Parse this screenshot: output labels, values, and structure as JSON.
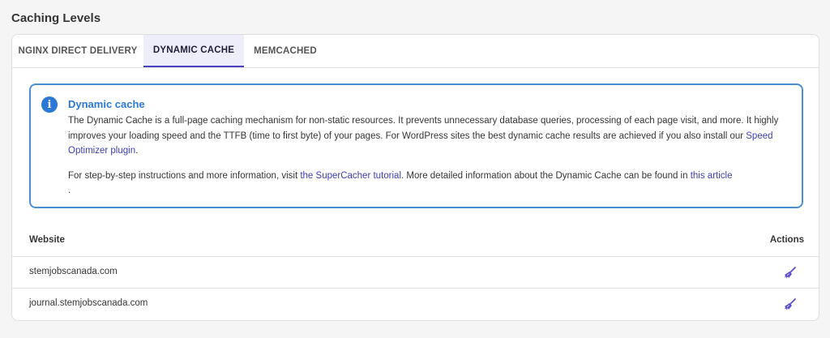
{
  "page": {
    "title": "Caching Levels"
  },
  "tabs": [
    {
      "label": "NGINX DIRECT DELIVERY",
      "active": false
    },
    {
      "label": "DYNAMIC CACHE",
      "active": true
    },
    {
      "label": "MEMCACHED",
      "active": false
    }
  ],
  "notice": {
    "title": "Dynamic cache",
    "icon": "info-icon",
    "p1_text": "The Dynamic Cache is a full-page caching mechanism for non-static resources. It prevents unnecessary database queries, processing of each page visit, and more. It highly improves your loading speed and the TTFB (time to first byte) of your pages. For WordPress sites the best dynamic cache results are achieved if you also install our ",
    "p1_link": "Speed Optimizer plugin",
    "p1_end": ".",
    "p2_text": "For step-by-step instructions and more information, visit ",
    "p2_link1": "the SuperCacher tutorial",
    "p2_mid": ". More detailed information about the Dynamic Cache can be found in ",
    "p2_link2": "this article",
    "p2_end": "."
  },
  "table": {
    "col_website": "Website",
    "col_actions": "Actions",
    "rows": [
      {
        "website": "stemjobscanada.com",
        "action_icon": "broom-icon"
      },
      {
        "website": "journal.stemjobscanada.com",
        "action_icon": "broom-icon"
      }
    ]
  },
  "colors": {
    "accent": "#4a43c7",
    "info_blue": "#2b78d6",
    "link": "#3c3fb8",
    "active_tab_bg": "#eeeefb"
  }
}
